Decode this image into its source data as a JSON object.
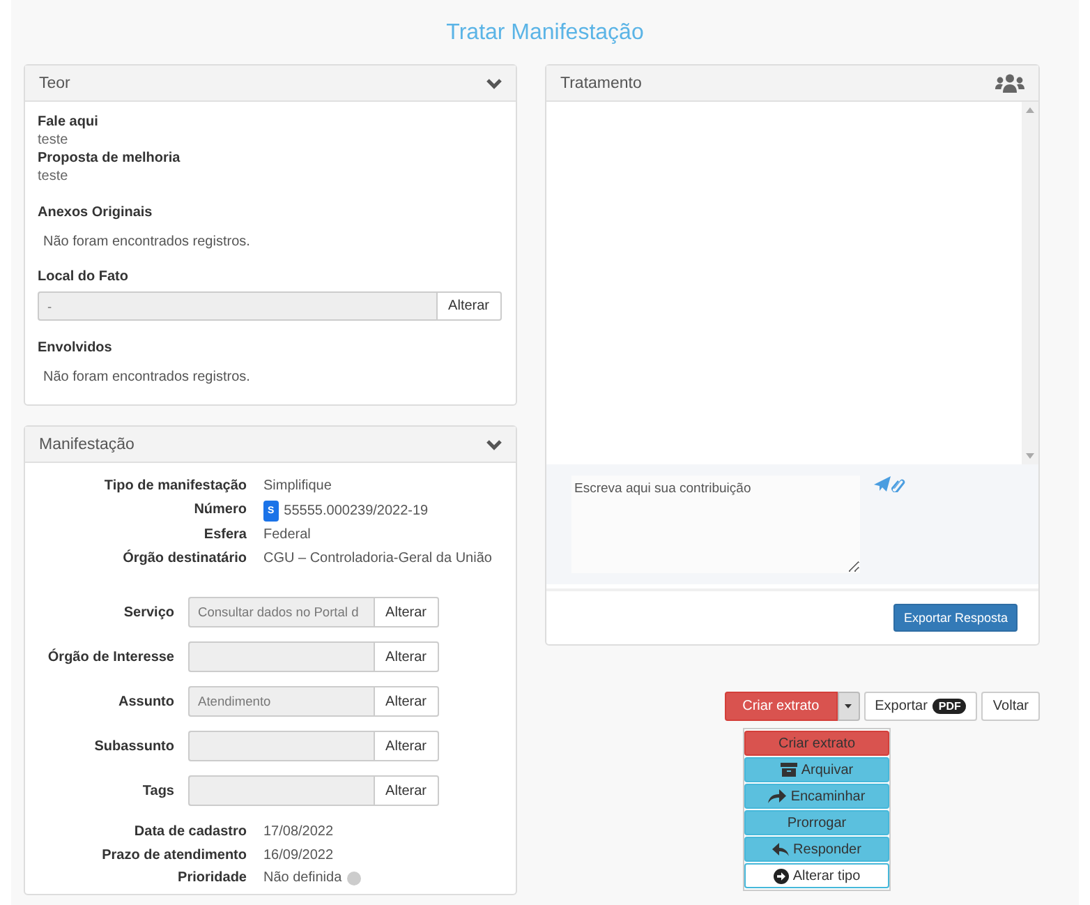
{
  "page": {
    "title": "Tratar Manifestação"
  },
  "teor": {
    "title": "Teor",
    "sections": [
      {
        "kind": "pairs",
        "items": [
          {
            "label": "Fale aqui",
            "value": "teste"
          },
          {
            "label": "Proposta de melhoria",
            "value": "teste"
          }
        ]
      },
      {
        "kind": "empty",
        "title": "Anexos Originais",
        "message": "Não foram encontrados registros."
      },
      {
        "kind": "field",
        "title": "Local do Fato",
        "value": "-",
        "button": "Alterar"
      },
      {
        "kind": "empty",
        "title": "Envolvidos",
        "message": "Não foram encontrados registros."
      }
    ]
  },
  "manifestacao": {
    "title": "Manifestação",
    "info": [
      {
        "label": "Tipo de manifestação",
        "value": "Simplifique"
      },
      {
        "label": "Número",
        "badge": "S",
        "value": "55555.000239/2022-19"
      },
      {
        "label": "Esfera",
        "value": "Federal"
      },
      {
        "label": "Órgão destinatário",
        "value": "CGU – Controladoria-Geral da União"
      }
    ],
    "fields": [
      {
        "label": "Serviço",
        "value": "Consultar dados no Portal d",
        "button": "Alterar"
      },
      {
        "label": "Órgão de Interesse",
        "button": "Alterar"
      },
      {
        "label": "Assunto",
        "value": "Atendimento",
        "button": "Alterar"
      },
      {
        "label": "Subassunto",
        "button": "Alterar"
      },
      {
        "label": "Tags",
        "button": "Alterar"
      }
    ],
    "dates": [
      {
        "label": "Data de cadastro",
        "value": "17/08/2022"
      },
      {
        "label": "Prazo de atendimento",
        "value": "16/09/2022"
      },
      {
        "label": "Prioridade",
        "value": "Não definida",
        "dot": true
      }
    ]
  },
  "tratamento": {
    "title": "Tratamento",
    "placeholder": "Escreva aqui sua contribuição",
    "export_button": "Exportar Resposta"
  },
  "actions": {
    "split_button": "Criar extrato",
    "export": "Exportar",
    "export_badge": "PDF",
    "back": "Voltar",
    "menu": [
      {
        "label": "Criar extrato",
        "kind": "danger"
      },
      {
        "label": "Arquivar",
        "kind": "info"
      },
      {
        "label": "Encaminhar",
        "kind": "info"
      },
      {
        "label": "Prorrogar",
        "kind": "info"
      },
      {
        "label": "Responder",
        "kind": "info"
      },
      {
        "label": "Alterar tipo",
        "kind": "default"
      }
    ]
  }
}
